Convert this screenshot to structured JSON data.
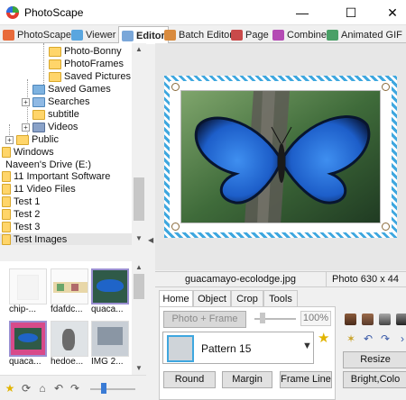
{
  "window": {
    "title": "PhotoScape",
    "minimize": "—",
    "maximize": "☐",
    "close": "✕"
  },
  "tabs": [
    "PhotoScape",
    "Viewer",
    "Editor",
    "Batch Editor",
    "Page",
    "Combine",
    "Animated GIF"
  ],
  "tree": {
    "items": [
      "Photo-Bonny",
      "PhotoFrames",
      "Saved Pictures",
      "Saved Games",
      "Searches",
      "subtitle",
      "Videos",
      "Public",
      "Windows",
      "Naveen's Drive (E:)",
      "11 Important Software",
      "11 Video Files",
      "Test 1",
      "Test 2",
      "Test 3",
      "Test Images"
    ],
    "expander_plus": "+"
  },
  "thumbnails": [
    {
      "label": "chip-..."
    },
    {
      "label": "fdafdc..."
    },
    {
      "label": "quaca..."
    },
    {
      "label": "quaca..."
    },
    {
      "label": "hedoe..."
    },
    {
      "label": "IMG 2..."
    }
  ],
  "file_bar": {
    "filename": "guacamayo-ecolodge.jpg",
    "info": "Photo 630 x 44"
  },
  "editor_tabs": [
    "Home",
    "Object",
    "Crop",
    "Tools"
  ],
  "home": {
    "photo_frame_button": "Photo + Frame",
    "percent": "100%",
    "frame_pattern": "Pattern 15",
    "round_button": "Round",
    "margin_button": "Margin",
    "frameline_button": "Frame Line",
    "resize_button": "Resize",
    "bright_button": "Bright,Colo"
  },
  "icons": {
    "minimize": "window-minimize-icon",
    "close": "close-icon",
    "star": "favorite-star-icon"
  },
  "colors": {
    "accent": "#3ea7df",
    "folder": "#ffd56a",
    "butterfly": "#1e5fc8"
  }
}
